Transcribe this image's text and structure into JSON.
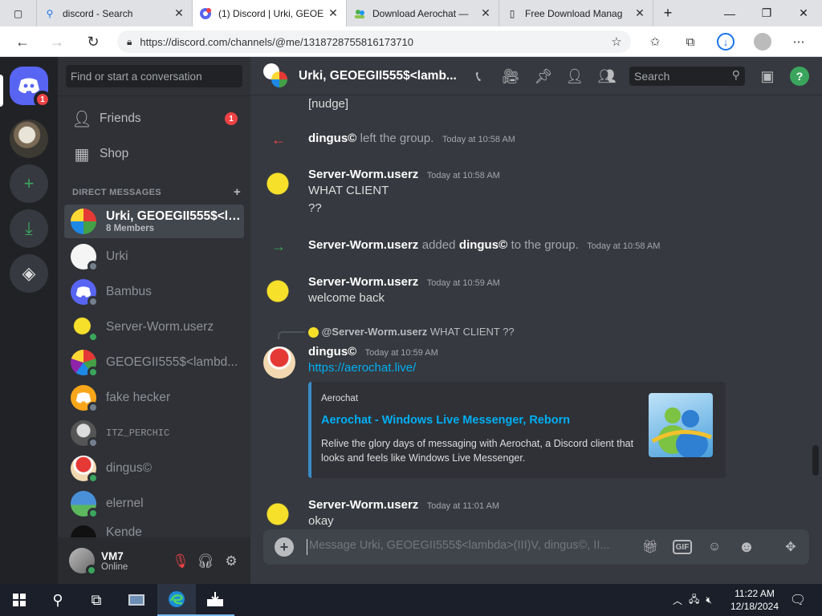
{
  "browser": {
    "tabs": [
      {
        "title": "discord - Search",
        "icon": "search-icon"
      },
      {
        "title": "(1) Discord | Urki, GEOE",
        "icon": "discord-icon"
      },
      {
        "title": "Download Aerochat —",
        "icon": "aerochat-icon"
      },
      {
        "title": "Free Download Manag",
        "icon": "page-icon"
      }
    ],
    "url": "https://discord.com/channels/@me/1318728755816173710"
  },
  "servers": {
    "home_badge": "1"
  },
  "dm_sidebar": {
    "search_placeholder": "Find or start a conversation",
    "friends_label": "Friends",
    "friends_badge": "1",
    "shop_label": "Shop",
    "section_title": "DIRECT MESSAGES",
    "add_symbol": "+",
    "dms": [
      {
        "name": "Urki, GEOEGII555$<la...",
        "sub": "8 Members",
        "selected": true
      },
      {
        "name": "Urki",
        "sub": ""
      },
      {
        "name": "Bambus",
        "sub": ""
      },
      {
        "name": "Server-Worm.userz",
        "sub": ""
      },
      {
        "name": "GEOEGII555$<lambd...",
        "sub": ""
      },
      {
        "name": "fake hecker",
        "sub": ""
      },
      {
        "name": "ITZ_PERCHIC",
        "sub": ""
      },
      {
        "name": "dingus©",
        "sub": ""
      },
      {
        "name": "elernel",
        "sub": ""
      },
      {
        "name": "Kende",
        "sub": ""
      }
    ],
    "user": {
      "name": "VM7",
      "status": "Online"
    }
  },
  "chat": {
    "title": "Urki, GEOEGII555$<lamb...",
    "search_placeholder": "Search",
    "messages": {
      "nudge": "[nudge]",
      "left_author": "dingus©",
      "left_text": "left the group.",
      "left_ts": "Today at 10:58 AM",
      "m1_author": "Server-Worm.userz",
      "m1_ts": "Today at 10:58 AM",
      "m1_line1": "WHAT CLIENT",
      "m1_line2": "??",
      "add_author": "Server-Worm.userz",
      "add_text": "added",
      "add_target": "dingus©",
      "add_text2": "to the group.",
      "add_ts": "Today at 10:58 AM",
      "m2_author": "Server-Worm.userz",
      "m2_ts": "Today at 10:59 AM",
      "m2_text": "welcome back",
      "reply_author": "@Server-Worm.userz",
      "reply_text": "WHAT CLIENT ??",
      "m3_author": "dingus©",
      "m3_ts": "Today at 10:59 AM",
      "m3_link": "https://aerochat.live/",
      "embed_site": "Aerochat",
      "embed_title": "Aerochat - Windows Live Messenger, Reborn",
      "embed_desc": "Relive the glory days of messaging with Aerochat, a Discord client that looks and feels like Windows Live Messenger.",
      "m4_author": "Server-Worm.userz",
      "m4_ts": "Today at 11:01 AM",
      "m4_text": "okay"
    },
    "composer_placeholder": "Message Urki, GEOEGII555$<lambda>(III)V, dingus©, II..."
  },
  "taskbar": {
    "time": "11:22 AM",
    "date": "12/18/2024"
  },
  "colors": {
    "blurple": "#5865f2",
    "online": "#3ba55d",
    "link": "#00aff4",
    "badge": "#ed4245"
  }
}
